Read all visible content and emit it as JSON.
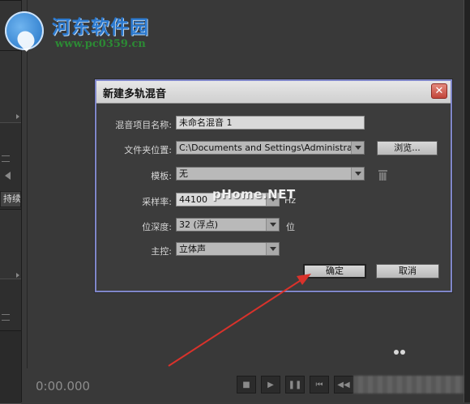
{
  "watermark": {
    "logo_title": "河东软件园",
    "logo_url": "www.pc0359.cn",
    "overlay": "pHome.NET"
  },
  "app": {
    "side_tab_label": "持续",
    "timecode": "0:00.000",
    "transport_icons": [
      "stop-icon",
      "play-icon",
      "pause-icon",
      "skip-to-start-icon",
      "rewind-icon"
    ]
  },
  "dialog": {
    "title": "新建多轨混音",
    "close_glyph": "✕",
    "mix_name": {
      "label": "混音项目名称:",
      "value": "未命名混音 1"
    },
    "folder": {
      "label": "文件夹位置:",
      "value": "C:\\Documents and Settings\\Administrator...",
      "browse_label": "浏览..."
    },
    "template": {
      "label": "模板:",
      "value": "无"
    },
    "sample_rate": {
      "label": "采样率:",
      "value": "44100",
      "unit": "Hz"
    },
    "bit_depth": {
      "label": "位深度:",
      "value": "32 (浮点)",
      "unit": "位"
    },
    "master": {
      "label": "主控:",
      "value": "立体声"
    },
    "ok_label": "确定",
    "cancel_label": "取消"
  },
  "annotation": {
    "arrow_color": "#d9322b"
  }
}
